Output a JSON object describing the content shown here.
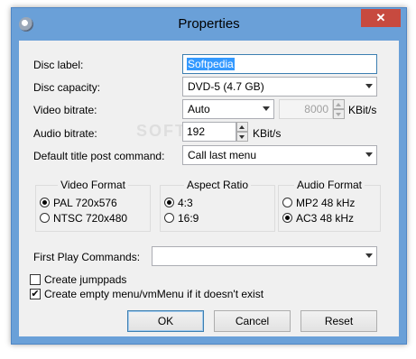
{
  "window": {
    "title": "Properties",
    "close_glyph": "✕",
    "app_icon": "disc-icon"
  },
  "form": {
    "disc_label": {
      "label": "Disc label:",
      "value": "Softpedia"
    },
    "disc_capacity": {
      "label": "Disc capacity:",
      "value": "DVD-5 (4.7 GB)"
    },
    "video_bitrate": {
      "label": "Video bitrate:",
      "mode": "Auto",
      "value": "8000",
      "unit": "KBit/s"
    },
    "audio_bitrate": {
      "label": "Audio bitrate:",
      "value": "192",
      "unit": "KBit/s"
    },
    "post_command": {
      "label": "Default title post command:",
      "value": "Call last menu"
    }
  },
  "video_format": {
    "title": "Video Format",
    "options": [
      "PAL 720x576",
      "NTSC 720x480"
    ],
    "selected": 0
  },
  "aspect_ratio": {
    "title": "Aspect Ratio",
    "options": [
      "4:3",
      "16:9"
    ],
    "selected": 0
  },
  "audio_format": {
    "title": "Audio Format",
    "options": [
      "MP2 48 kHz",
      "AC3 48 kHz"
    ],
    "selected": 1
  },
  "first_play": {
    "label": "First Play Commands:",
    "value": ""
  },
  "checks": {
    "jumppads": {
      "label": "Create jumppads",
      "checked": false
    },
    "empty_menu": {
      "label": "Create empty menu/vmMenu if it doesn't exist",
      "checked": true
    }
  },
  "buttons": {
    "ok": "OK",
    "cancel": "Cancel",
    "reset": "Reset"
  },
  "watermark": "SOFTPEDIA"
}
